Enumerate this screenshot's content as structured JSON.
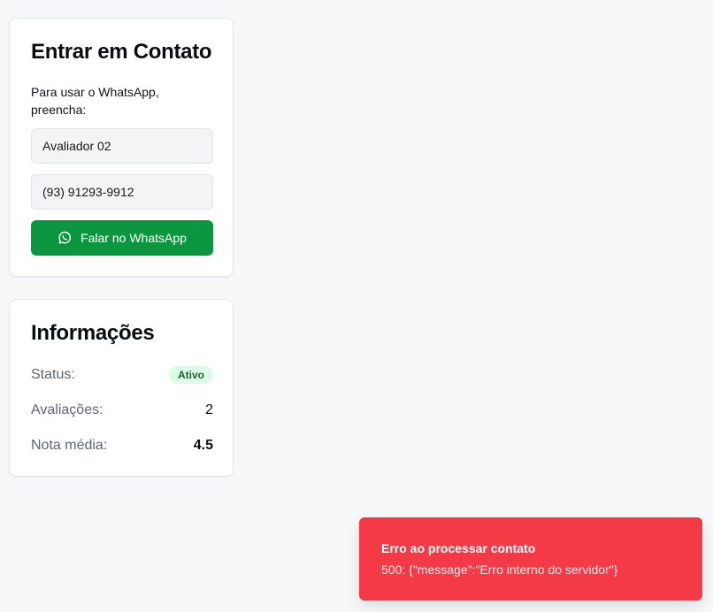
{
  "contact": {
    "title": "Entrar em Contato",
    "description": "Para usar o WhatsApp, preencha:",
    "name_value": "Avaliador 02",
    "phone_value": "(93) 91293-9912",
    "whatsapp_button_label": "Falar no WhatsApp",
    "whatsapp_icon": "whatsapp-icon"
  },
  "info": {
    "title": "Informações",
    "status_label": "Status:",
    "status_value": "Ativo",
    "evaluations_label": "Avaliações:",
    "evaluations_value": "2",
    "average_label": "Nota média:",
    "average_value": "4.5"
  },
  "toast": {
    "title": "Erro ao processar contato",
    "description": "500: {\"message\":\"Erro interno do servidor\"}"
  },
  "colors": {
    "background": "#f7f8fa",
    "whatsapp_green": "#0c9640",
    "status_badge_bg": "#dcfce7",
    "status_badge_text": "#166534",
    "toast_bg": "#f43a46"
  }
}
